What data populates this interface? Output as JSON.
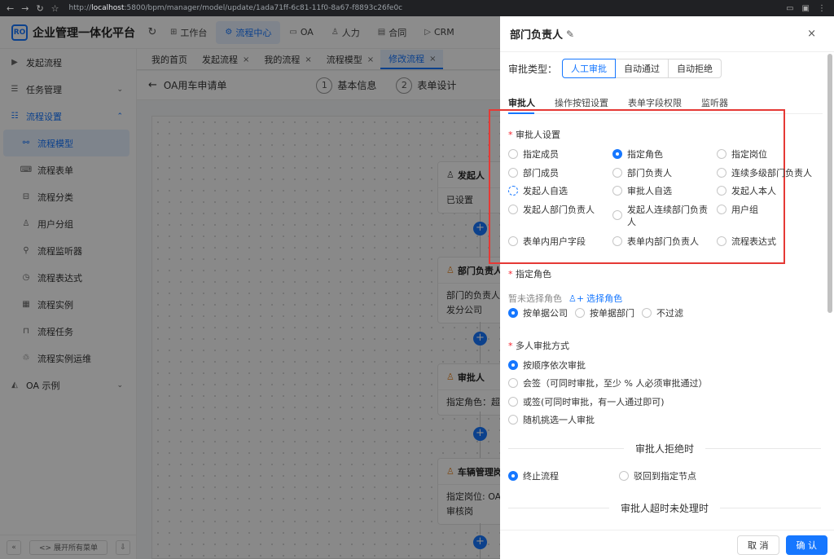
{
  "browser": {
    "url_prefix": "http://",
    "url_host": "localhost",
    "url_rest": ":5800/bpm/manager/model/update/1ada71ff-6c81-11f0-8a67-f8893c26fe0c",
    "back": "←",
    "forward": "→",
    "reload": "↻",
    "star": "☆"
  },
  "app": {
    "logo": "RO",
    "title": "企业管理一体化平台",
    "top_menu": [
      {
        "label": "工作台",
        "icon": "⊞"
      },
      {
        "label": "流程中心",
        "icon": "⚙"
      },
      {
        "label": "OA",
        "icon": "▭"
      },
      {
        "label": "人力",
        "icon": "♙"
      },
      {
        "label": "合同",
        "icon": "▤"
      },
      {
        "label": "CRM",
        "icon": "▷"
      }
    ]
  },
  "sidebar": {
    "items": [
      {
        "label": "发起流程",
        "icon": "▶"
      },
      {
        "label": "任务管理",
        "icon": "☰",
        "chevron": "⌄"
      },
      {
        "label": "流程设置",
        "icon": "☷",
        "chevron": "⌃"
      },
      {
        "label": "流程模型",
        "icon": "⚯"
      },
      {
        "label": "流程表单",
        "icon": "⌨"
      },
      {
        "label": "流程分类",
        "icon": "⊟"
      },
      {
        "label": "用户分组",
        "icon": "♙"
      },
      {
        "label": "流程监听器",
        "icon": "⚲"
      },
      {
        "label": "流程表达式",
        "icon": "◷"
      },
      {
        "label": "流程实例",
        "icon": "▦"
      },
      {
        "label": "流程任务",
        "icon": "⊓"
      },
      {
        "label": "流程实例运维",
        "icon": "♲"
      },
      {
        "label": "OA 示例",
        "icon": "◭",
        "chevron": "⌄"
      }
    ],
    "footer_left": "«",
    "expand_all": "<> 展开所有菜单",
    "footer_right": "⇩"
  },
  "tabs": [
    {
      "label": "我的首页"
    },
    {
      "label": "发起流程",
      "close": "×"
    },
    {
      "label": "我的流程",
      "close": "×"
    },
    {
      "label": "流程模型",
      "close": "×"
    },
    {
      "label": "修改流程",
      "close": "×"
    }
  ],
  "model_bar": {
    "back": "←",
    "name": "OA用车申请单",
    "steps": [
      {
        "num": "1",
        "label": "基本信息"
      },
      {
        "num": "2",
        "label": "表单设计"
      }
    ]
  },
  "flow_nodes": [
    {
      "title": "发起人",
      "body": [
        "已设置"
      ],
      "icon": "♙"
    },
    {
      "title": "部门负责人",
      "body": [
        "部门的负责人：济",
        "发分公司"
      ],
      "icon": "♙"
    },
    {
      "title": "审批人",
      "body": [
        "指定角色：超级管"
      ],
      "icon": "♙"
    },
    {
      "title": "车辆管理岗",
      "body": [
        "指定岗位: OA_用车",
        "审核岗"
      ],
      "icon": "♙"
    }
  ],
  "add_symbol": "+",
  "drawer": {
    "title": "部门负责人",
    "edit_icon": "✎",
    "close": "×",
    "approve_type_label": "审批类型：",
    "approve_types": [
      "人工审批",
      "自动通过",
      "自动拒绝"
    ],
    "sub_tabs": [
      "审批人",
      "操作按钮设置",
      "表单字段权限",
      "监听器"
    ],
    "approver_setting_label": "审批人设置",
    "approver_options": [
      [
        "指定成员",
        "指定角色",
        "指定岗位"
      ],
      [
        "部门成员",
        "部门负责人",
        "连续多级部门负责人"
      ],
      [
        "发起人自选",
        "审批人自选",
        "发起人本人"
      ],
      [
        "发起人部门负责人",
        "发起人连续部门负责人",
        "用户组"
      ],
      [
        "表单内用户字段",
        "表单内部门负责人",
        "流程表达式"
      ]
    ],
    "role_label": "指定角色",
    "role_empty": "暂未选择角色",
    "role_select": "选择角色",
    "role_select_icon": "♙+",
    "filter_options": [
      "按单据公司",
      "按单据部门",
      "不过滤"
    ],
    "multi_label": "多人审批方式",
    "multi_options": [
      "按顺序依次审批",
      "会签（可同时审批，至少 % 人必须审批通过）",
      "或签(可同时审批，有一人通过即可)",
      "随机挑选一人审批"
    ],
    "reject_title": "审批人拒绝时",
    "reject_options": [
      "终止流程",
      "驳回到指定节点"
    ],
    "timeout_title": "审批人超时未处理时",
    "cancel": "取 消",
    "confirm": "确 认"
  }
}
